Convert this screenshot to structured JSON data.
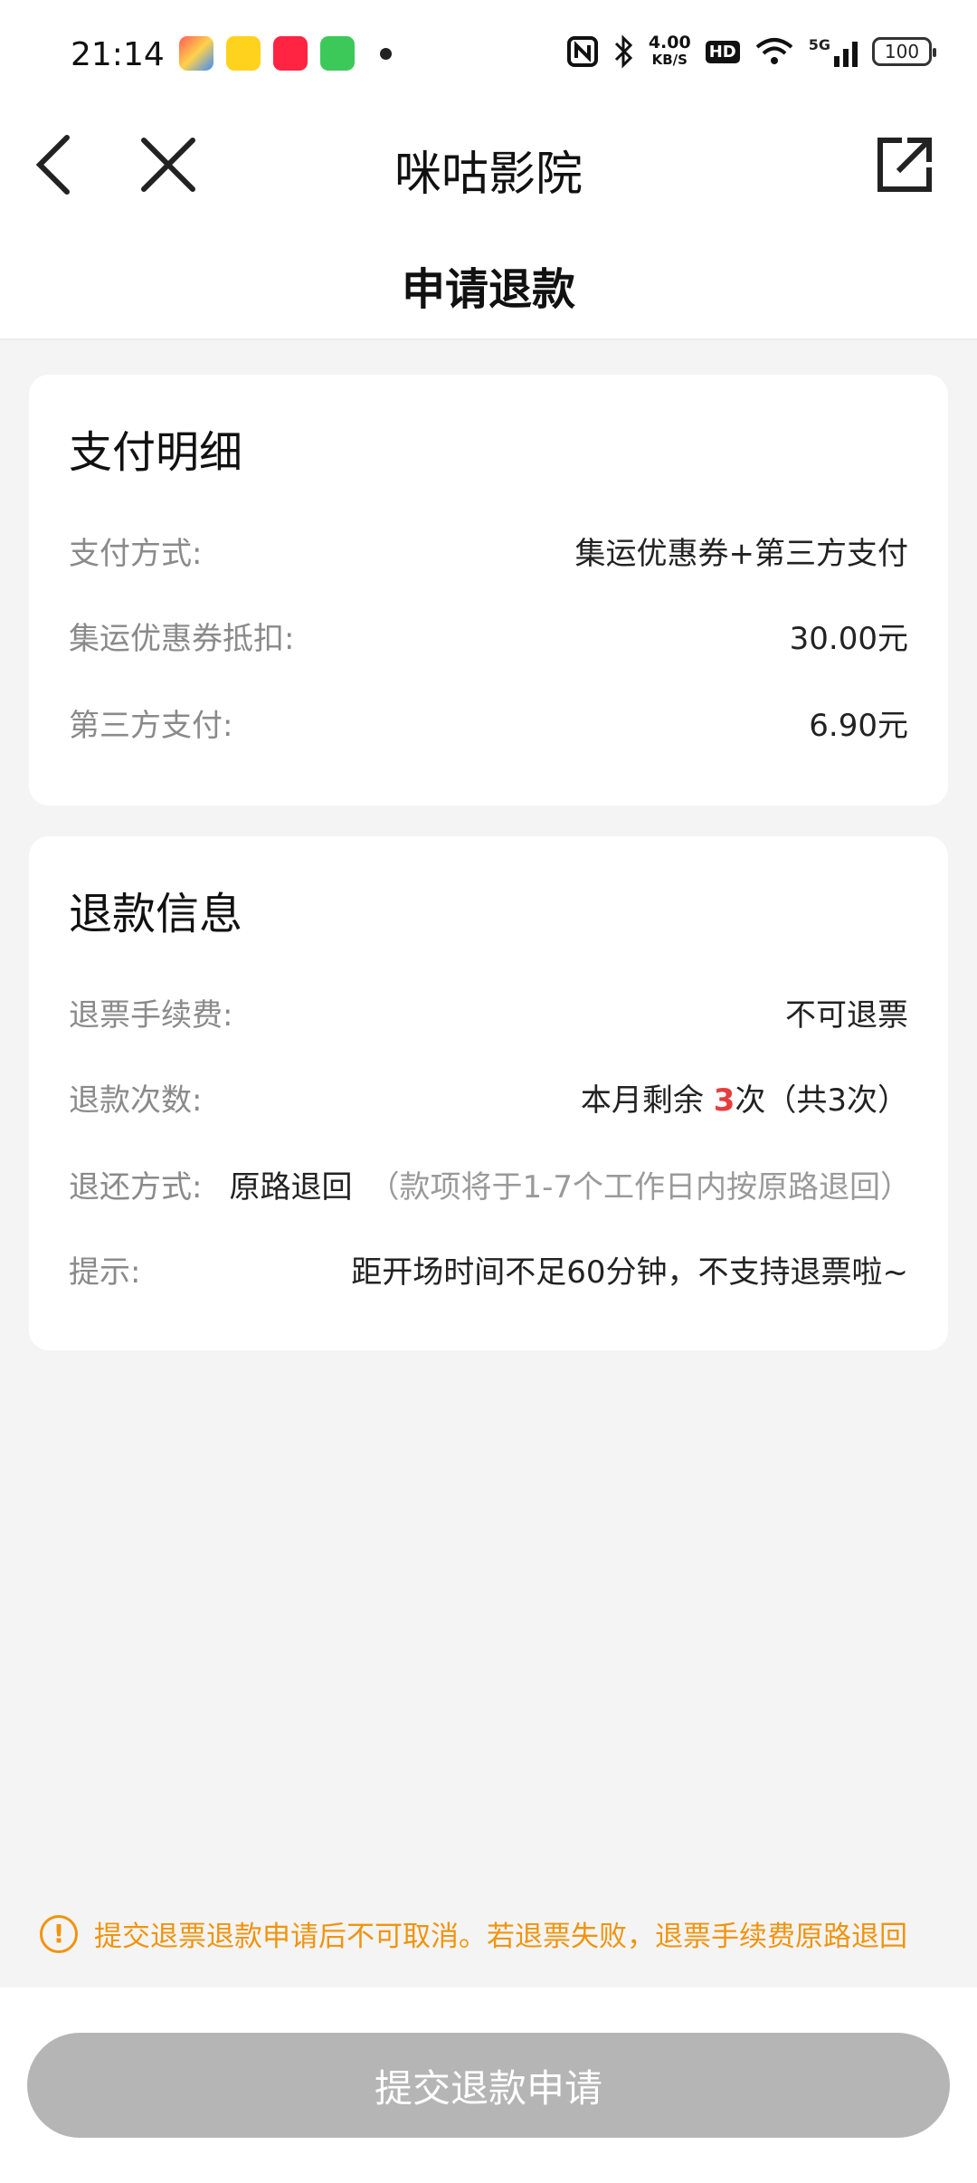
{
  "status_bar": {
    "time": "21:14",
    "net_speed_value": "4.00",
    "net_speed_unit": "KB/S",
    "hd_badge": "HD",
    "signal": "5G",
    "battery": "100",
    "icons": [
      "app-icon-1",
      "app-icon-2",
      "xiaohongshu-icon",
      "messages-icon",
      "notification-dot",
      "nfc-icon",
      "bluetooth-icon",
      "wifi-icon",
      "signal-icon"
    ]
  },
  "nav": {
    "title": "咪咕影院"
  },
  "page": {
    "title": "申请退款"
  },
  "payment": {
    "title": "支付明细",
    "rows": [
      {
        "label": "支付方式:",
        "value": "集运优惠券+第三方支付"
      },
      {
        "label": "集运优惠券抵扣:",
        "value": "30.00元"
      },
      {
        "label": "第三方支付:",
        "value": "6.90元"
      }
    ]
  },
  "refund": {
    "title": "退款信息",
    "fee_label": "退票手续费:",
    "fee_value": "不可退票",
    "count_label": "退款次数:",
    "count_prefix": "本月剩余 ",
    "count_number": "3",
    "count_suffix": "次（共3次）",
    "method_label": "退还方式:",
    "method_value": "原路退回",
    "method_note": "（款项将于1-7个工作日内按原路退回）",
    "tip_label": "提示:",
    "tip_value": "距开场时间不足60分钟，不支持退票啦~"
  },
  "notice": {
    "icon": "!",
    "text": "提交退票退款申请后不可取消。若退票失败，退票手续费原路退回"
  },
  "submit_label": "提交退款申请",
  "colors": {
    "background": "#f4f4f4",
    "accent_red": "#e83c3c",
    "notice_orange": "#f0940f",
    "button_disabled": "#b5b5b5"
  }
}
